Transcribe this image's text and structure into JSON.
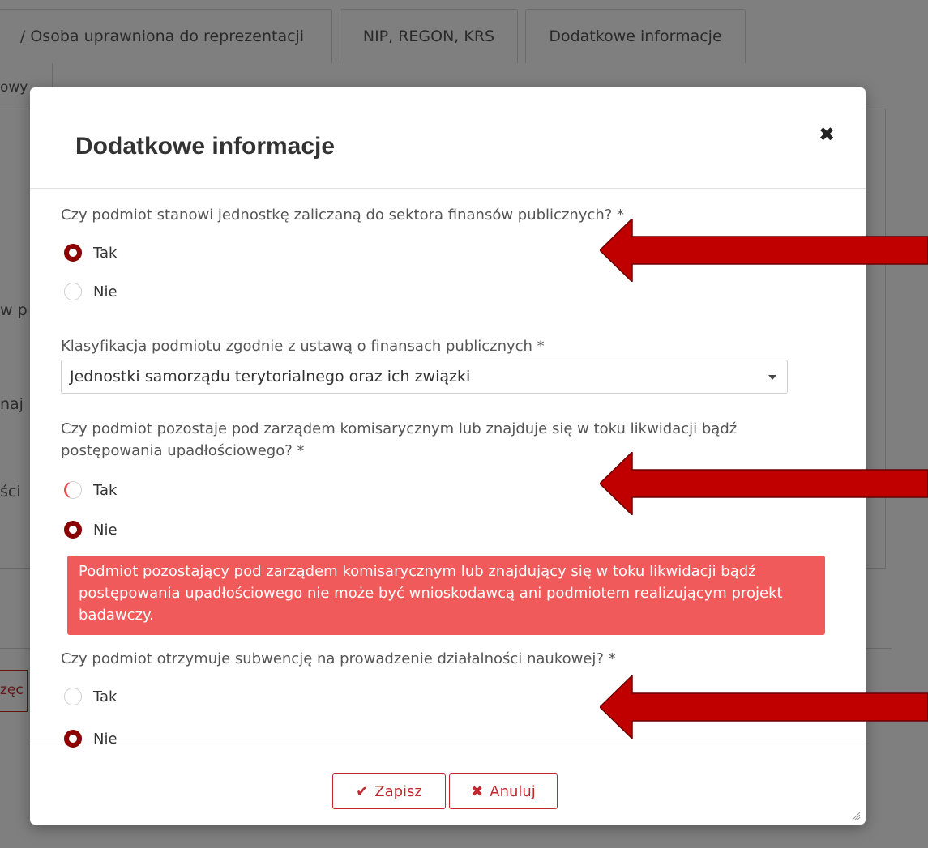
{
  "background": {
    "tabs": [
      "/ Osoba uprawniona do reprezentacji",
      "NIP, REGON, KRS",
      "Dodatkowe informacje"
    ],
    "tab_second_row": "owy",
    "snippets": [
      "w p",
      "naj",
      "ści"
    ],
    "button_fragment": "zęc"
  },
  "modal": {
    "title": "Dodatkowe informacje",
    "close_icon": "close-icon",
    "questions": {
      "sector": {
        "label": "Czy podmiot stanowi jednostkę zaliczaną do sektora finansów publicznych? *",
        "options": [
          "Tak",
          "Nie"
        ],
        "selected": "Tak"
      },
      "classification": {
        "label": "Klasyfikacja podmiotu zgodnie z ustawą o finansach publicznych *",
        "value": "Jednostki samorządu terytorialnego oraz ich związki"
      },
      "administration": {
        "label": "Czy podmiot pozostaje pod zarządem komisarycznym lub znajduje się w toku likwidacji bądź postępowania upadłościowego? *",
        "options": [
          "Tak",
          "Nie"
        ],
        "selected": "Nie",
        "alert": "Podmiot pozostający pod zarządem komisarycznym lub znajdujący się w toku likwidacji bądź postępowania upadłościowego nie może być wnioskodawcą ani podmiotem realizującym projekt badawczy."
      },
      "subsidy": {
        "label": "Czy podmiot otrzymuje subwencję na prowadzenie działalności naukowej? *",
        "options": [
          "Tak",
          "Nie"
        ],
        "selected": "Nie"
      }
    },
    "footer": {
      "save_label": "Zapisz",
      "save_icon": "check-icon",
      "cancel_label": "Anuluj",
      "cancel_icon": "x-icon"
    }
  },
  "annotations": {
    "arrow_color": "#c00000",
    "arrow_count": 3
  },
  "colors": {
    "accent": "#8b0000",
    "button_border": "#c0282d",
    "alert_bg": "#f05a5a"
  }
}
